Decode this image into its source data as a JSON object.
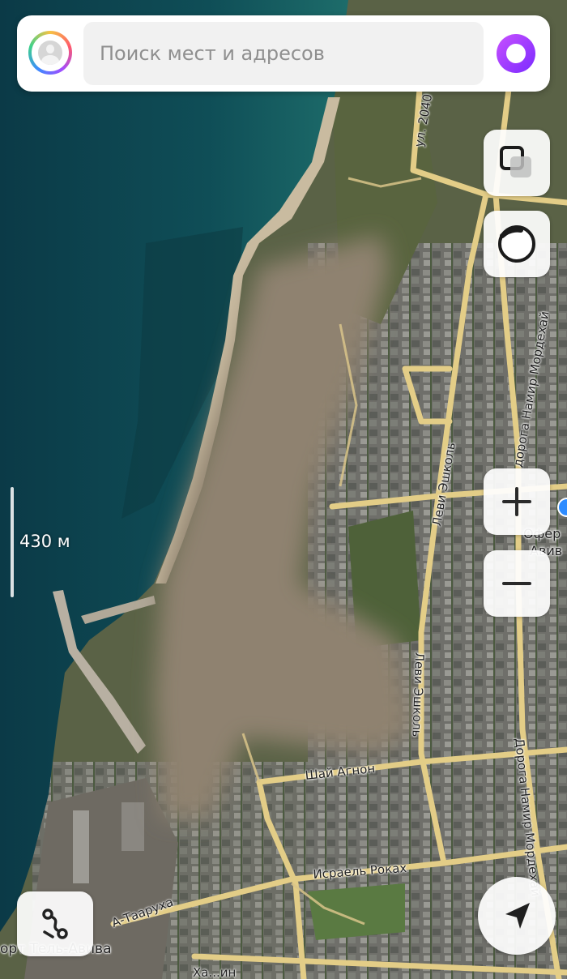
{
  "search": {
    "placeholder": "Поиск мест и адресов"
  },
  "scale": {
    "label": "430 м"
  },
  "map_labels": {
    "ul_2040": "ул. 2040",
    "levi_eshkol_1": "Леви Эшколь",
    "levi_eshkol_2": "Леви Эшколь",
    "doroga_namir_1": "дорога Намир Мордехай",
    "doroga_namir_2": "Дорога Намир Мордехай",
    "ofer": "Офер",
    "aviv": "Авив",
    "shai_agnon": "Шай Агнон",
    "israel_rokah": "Исраель Роках",
    "a_taarukha": "А-Таарухa",
    "port_tel_aviv": "орт Тель-Авива",
    "bottom_street": "Ха...ин"
  },
  "icons": {
    "layers": "layers-icon",
    "traffic": "traffic-icon",
    "zoom_in": "plus-icon",
    "zoom_out": "minus-icon",
    "route": "route-icon",
    "locate": "navigation-arrow-icon",
    "alice": "alice-voice-icon",
    "avatar": "user-avatar-icon"
  },
  "colors": {
    "sea": "#0f4a52",
    "roads": "#e6cf86",
    "alice_accent": "#9a3bff"
  }
}
